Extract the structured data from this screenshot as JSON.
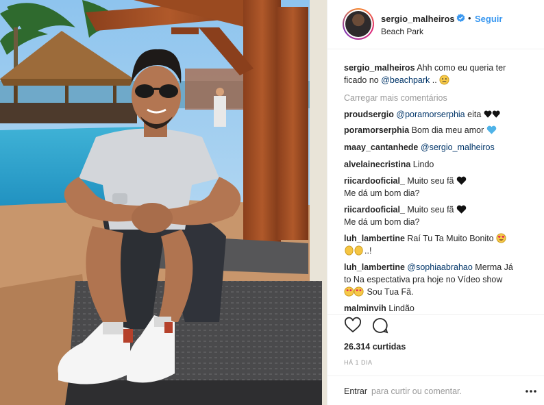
{
  "post": {
    "username": "sergio_malheiros",
    "follow_label": "Seguir",
    "dot": "•",
    "location": "Beach Park"
  },
  "caption": {
    "username": "sergio_malheiros",
    "text_1": "Ahh como eu queria ter",
    "text_2": "ficado no ",
    "mention": "@beachpark",
    "text_3": " .. ",
    "emoji": "sad-face-emoji"
  },
  "load_more": "Carregar mais comentários",
  "comments": [
    {
      "user": "proudsergio",
      "mention": "@poramorserphia",
      "text": " eita ",
      "emoji": "black-hearts-emoji"
    },
    {
      "user": "poramorserphia",
      "text": "Bom dia meu amor ",
      "emoji": "blue-heart-emoji"
    },
    {
      "user": "maay_cantanhede",
      "mention": "@sergio_malheiros"
    },
    {
      "user": "alvelainecristina",
      "text": "Lindo"
    },
    {
      "user": "riicardooficial_",
      "text": "Muito seu fã ",
      "emoji": "black-heart-emoji",
      "line2": "Me dá um bom dia?"
    },
    {
      "user": "riicardooficial_",
      "text": "Muito seu fã ",
      "emoji": "black-heart-emoji",
      "line2": "Me dá um bom dia?"
    },
    {
      "user": "luh_lambertine",
      "text": "Raí Tu Ta Muito Bonito ",
      "emoji": "heart-eyes-emoji",
      "line2": "..!"
    },
    {
      "user": "luh_lambertine",
      "mention": "@sophiaabrahao",
      "text": " Merma Já",
      "line2": "to Na espectativa pra hoje no Vídeo show",
      "line3": " Sou Tua Fã."
    },
    {
      "user": "malminvih",
      "text": "Lindão"
    }
  ],
  "likes": "26.314 curtidas",
  "time": "HÁ 1 DIA",
  "compose": {
    "login": "Entrar",
    "placeholder": "para curtir ou comentar."
  },
  "colors": {
    "accent": "#3897f0",
    "mention": "#003569",
    "muted": "#999999",
    "text": "#262626",
    "border": "#efefef"
  },
  "icons": [
    "verified-badge-icon",
    "heart-icon",
    "comment-icon",
    "more-options-icon"
  ]
}
